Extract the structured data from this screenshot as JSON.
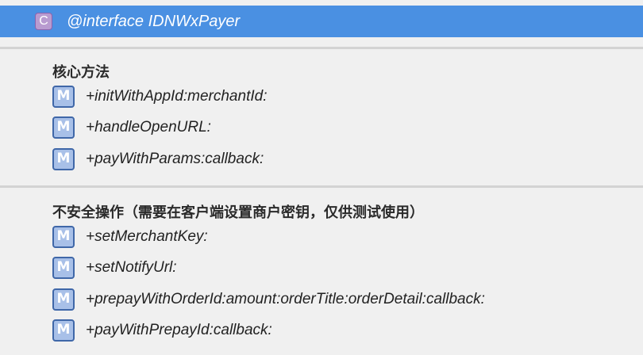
{
  "header": {
    "icon_letter": "C",
    "icon_name": "class-icon",
    "title": "@interface IDNWxPayer"
  },
  "sections": [
    {
      "title": "核心方法",
      "items": [
        {
          "icon_letter": "M",
          "label": "+initWithAppId:merchantId:"
        },
        {
          "icon_letter": "M",
          "label": "+handleOpenURL:"
        },
        {
          "icon_letter": "M",
          "label": "+payWithParams:callback:"
        }
      ]
    },
    {
      "title": "不安全操作（需要在客户端设置商户密钥，仅供测试使用）",
      "items": [
        {
          "icon_letter": "M",
          "label": "+setMerchantKey:"
        },
        {
          "icon_letter": "M",
          "label": "+setNotifyUrl:"
        },
        {
          "icon_letter": "M",
          "label": "+prepayWithOrderId:amount:orderTitle:orderDetail:callback:"
        },
        {
          "icon_letter": "M",
          "label": "+payWithPrepayId:callback:"
        }
      ]
    }
  ],
  "colors": {
    "header_bg": "#4a90e2",
    "class_icon_bg": "#b99bd0",
    "method_icon_bg": "#a8c0e8",
    "method_icon_border": "#3f67a8",
    "page_bg": "#f0f0f0"
  }
}
